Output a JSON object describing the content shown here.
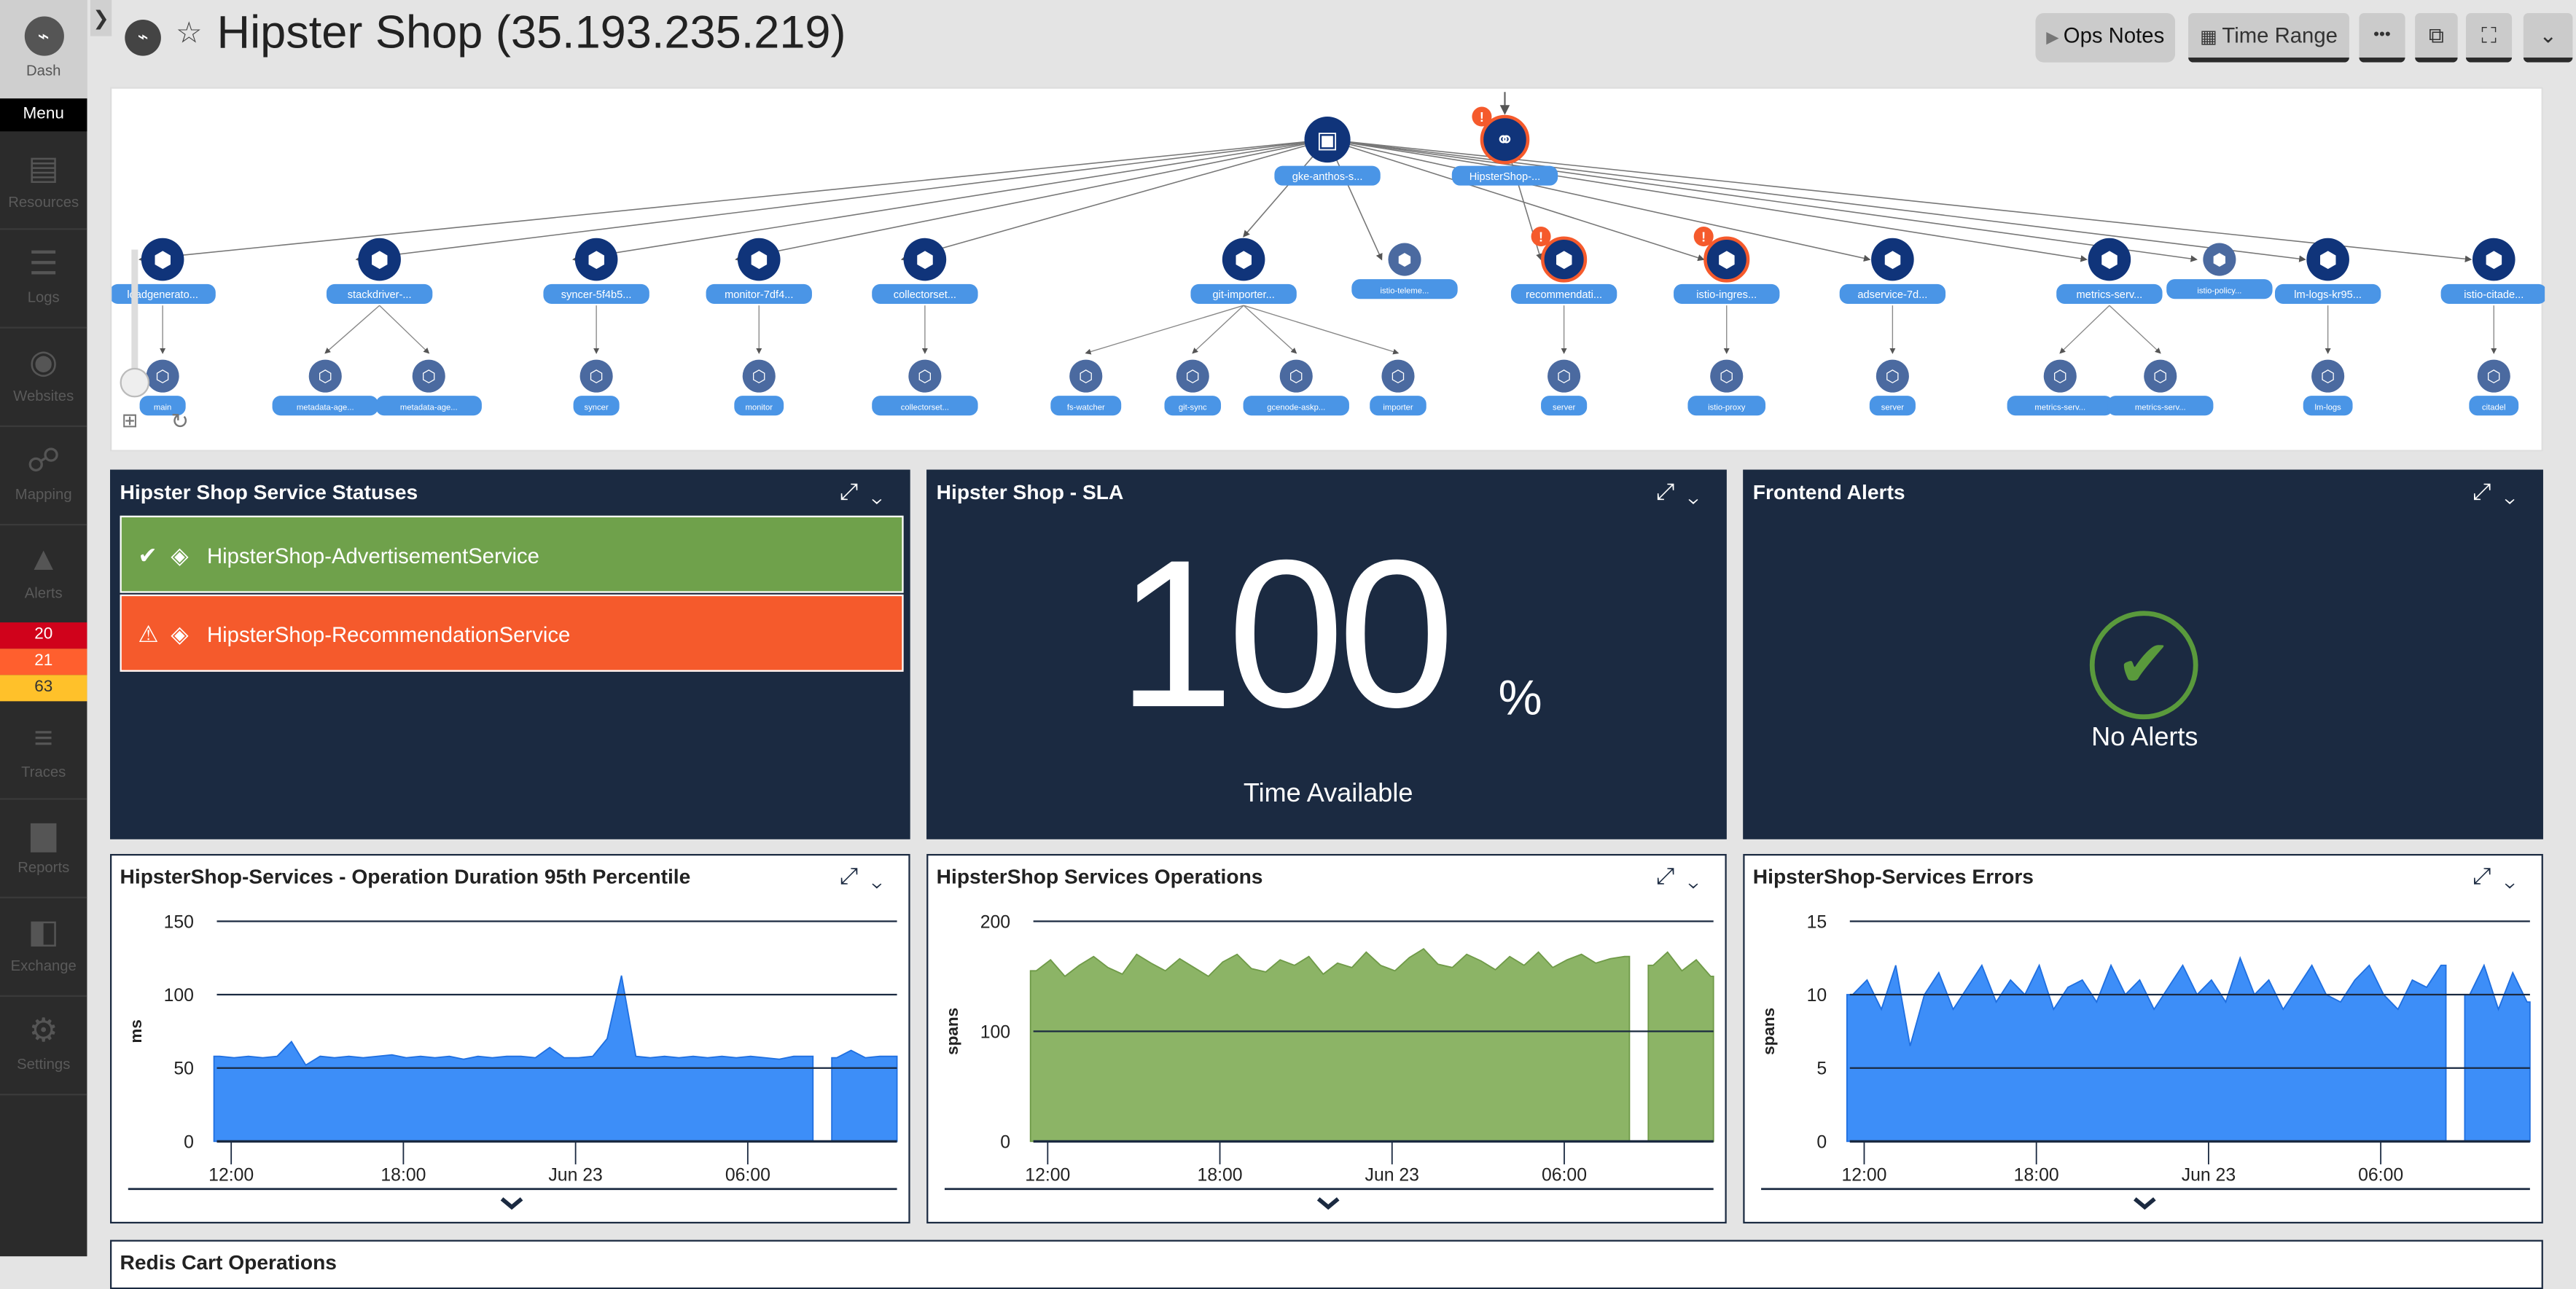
{
  "sidebar": {
    "dash_label": "Dash",
    "menu_label": "Menu",
    "items": [
      {
        "label": "Resources",
        "icon": "server-icon"
      },
      {
        "label": "Logs",
        "icon": "logs-icon"
      },
      {
        "label": "Websites",
        "icon": "globe-icon"
      },
      {
        "label": "Mapping",
        "icon": "mapping-icon"
      },
      {
        "label": "Alerts",
        "icon": "alert-icon"
      },
      {
        "label": "Traces",
        "icon": "traces-icon"
      },
      {
        "label": "Reports",
        "icon": "reports-icon"
      },
      {
        "label": "Exchange",
        "icon": "exchange-icon"
      },
      {
        "label": "Settings",
        "icon": "gear-icon"
      }
    ],
    "alert_counts": [
      {
        "value": "20",
        "color": "#d0021b"
      },
      {
        "value": "21",
        "color": "#ff5f2e"
      },
      {
        "value": "63",
        "color": "#ffc12a"
      }
    ]
  },
  "header": {
    "title": "Hipster Shop (35.193.235.219)",
    "ops_notes": "Ops Notes",
    "time_range": "Time Range"
  },
  "topology": {
    "top": [
      {
        "label": "gke-anthos-s...",
        "alert": false
      },
      {
        "label": "HipsterShop-...",
        "alert": true
      }
    ],
    "row1": [
      {
        "label": "loadgenerato..."
      },
      {
        "label": "stackdriver-..."
      },
      {
        "label": "syncer-5f4b5..."
      },
      {
        "label": "monitor-7df4..."
      },
      {
        "label": "collectorset..."
      },
      {
        "label": "git-importer..."
      },
      {
        "label": "istio-teleme..."
      },
      {
        "label": "recommendati...",
        "alert": true
      },
      {
        "label": "istio-ingres...",
        "alert": true
      },
      {
        "label": "adservice-7d..."
      },
      {
        "label": "metrics-serv..."
      },
      {
        "label": "istio-policy..."
      },
      {
        "label": "lm-logs-kr95..."
      },
      {
        "label": "istio-citade..."
      }
    ],
    "row2": [
      {
        "label": "main"
      },
      {
        "label": "metadata-age..."
      },
      {
        "label": "metadata-age..."
      },
      {
        "label": "syncer"
      },
      {
        "label": "monitor"
      },
      {
        "label": "collectorset..."
      },
      {
        "label": "fs-watcher"
      },
      {
        "label": "git-sync"
      },
      {
        "label": "gcenode-askp..."
      },
      {
        "label": "importer"
      },
      {
        "label": "server"
      },
      {
        "label": "istio-proxy"
      },
      {
        "label": "server"
      },
      {
        "label": "metrics-serv..."
      },
      {
        "label": "metrics-serv..."
      },
      {
        "label": "lm-logs"
      },
      {
        "label": "citadel"
      }
    ]
  },
  "statuses": {
    "title": "Hipster Shop Service Statuses",
    "items": [
      {
        "label": "HipsterShop-AdvertisementService",
        "state": "ok",
        "color": "#6fa14b"
      },
      {
        "label": "HipsterShop-RecommendationService",
        "state": "warning",
        "color": "#f55a2c"
      }
    ]
  },
  "sla": {
    "title": "Hipster Shop - SLA",
    "value": "100",
    "unit": "%",
    "caption": "Time Available"
  },
  "frontend": {
    "title": "Frontend Alerts",
    "message": "No Alerts",
    "color": "#5a9a3c"
  },
  "bottom_panel": {
    "title": "Redis Cart Operations"
  },
  "chart_data": [
    {
      "type": "area",
      "title": "HipsterShop-Services - Operation Duration 95th Percentile",
      "ylabel": "ms",
      "ylim": [
        0,
        150
      ],
      "yticks": [
        0,
        50,
        100,
        150
      ],
      "xticks": [
        "12:00",
        "18:00",
        "Jun 23",
        "06:00"
      ],
      "color": "#3d8ef8",
      "grid": true,
      "x": [
        "11:30",
        "12:00",
        "12:30",
        "13:00",
        "13:30",
        "14:00",
        "14:30",
        "15:00",
        "15:30",
        "16:00",
        "16:30",
        "17:00",
        "17:30",
        "18:00",
        "18:30",
        "19:00",
        "19:30",
        "20:00",
        "20:30",
        "21:00",
        "21:30",
        "22:00",
        "22:30",
        "23:00",
        "23:30",
        "00:00",
        "00:30",
        "01:00",
        "01:30",
        "02:00",
        "02:30",
        "03:00",
        "03:30",
        "04:00",
        "04:30",
        "05:00",
        "05:30",
        "06:00",
        "06:30",
        "07:00",
        "07:30",
        "08:00",
        "08:30",
        "09:00",
        "09:30",
        "10:00",
        "10:30",
        "11:00"
      ],
      "values": [
        58,
        57,
        58,
        57,
        58,
        68,
        52,
        58,
        57,
        58,
        57,
        58,
        59,
        57,
        58,
        57,
        58,
        56,
        58,
        57,
        58,
        58,
        57,
        64,
        57,
        57,
        58,
        70,
        113,
        58,
        57,
        58,
        57,
        58,
        57,
        58,
        57,
        58,
        57,
        56,
        58,
        58,
        null,
        57,
        62,
        57,
        58,
        58
      ]
    },
    {
      "type": "area",
      "title": "HipsterShop Services Operations",
      "ylabel": "spans",
      "ylim": [
        0,
        200
      ],
      "yticks": [
        0,
        100,
        200
      ],
      "xticks": [
        "12:00",
        "18:00",
        "Jun 23",
        "06:00"
      ],
      "color": "#8cb466",
      "grid": true,
      "x": [
        "11:30",
        "12:00",
        "12:30",
        "13:00",
        "13:30",
        "14:00",
        "14:30",
        "15:00",
        "15:30",
        "16:00",
        "16:30",
        "17:00",
        "17:30",
        "18:00",
        "18:30",
        "19:00",
        "19:30",
        "20:00",
        "20:30",
        "21:00",
        "21:30",
        "22:00",
        "22:30",
        "23:00",
        "23:30",
        "00:00",
        "00:30",
        "01:00",
        "01:30",
        "02:00",
        "02:30",
        "03:00",
        "03:30",
        "04:00",
        "04:30",
        "05:00",
        "05:30",
        "06:00",
        "06:30",
        "07:00",
        "07:30",
        "08:00",
        "08:30",
        "09:00",
        "09:30",
        "10:00",
        "10:30",
        "11:00"
      ],
      "values": [
        155,
        165,
        150,
        160,
        168,
        158,
        152,
        170,
        162,
        155,
        166,
        158,
        150,
        163,
        170,
        157,
        154,
        165,
        160,
        168,
        152,
        162,
        158,
        172,
        160,
        155,
        167,
        175,
        161,
        158,
        170,
        164,
        156,
        168,
        160,
        172,
        158,
        165,
        170,
        162,
        166,
        168,
        null,
        160,
        172,
        155,
        165,
        150
      ]
    },
    {
      "type": "area",
      "title": "HipsterShop-Services Errors",
      "ylabel": "spans",
      "ylim": [
        0,
        15
      ],
      "yticks": [
        0,
        5,
        10,
        15
      ],
      "xticks": [
        "12:00",
        "18:00",
        "Jun 23",
        "06:00"
      ],
      "color": "#3d8ef8",
      "grid": true,
      "x": [
        "11:30",
        "12:00",
        "12:30",
        "13:00",
        "13:30",
        "14:00",
        "14:30",
        "15:00",
        "15:30",
        "16:00",
        "16:30",
        "17:00",
        "17:30",
        "18:00",
        "18:30",
        "19:00",
        "19:30",
        "20:00",
        "20:30",
        "21:00",
        "21:30",
        "22:00",
        "22:30",
        "23:00",
        "23:30",
        "00:00",
        "00:30",
        "01:00",
        "01:30",
        "02:00",
        "02:30",
        "03:00",
        "03:30",
        "04:00",
        "04:30",
        "05:00",
        "05:30",
        "06:00",
        "06:30",
        "07:00",
        "07:30",
        "08:00",
        "08:30",
        "09:00",
        "09:30",
        "10:00",
        "10:30",
        "11:00"
      ],
      "values": [
        10,
        11,
        9,
        12,
        6.5,
        10,
        11.5,
        9,
        10.5,
        12,
        9.5,
        11,
        10,
        12,
        9,
        10.5,
        11,
        9.5,
        12,
        10,
        11,
        9,
        10.5,
        12,
        10,
        11,
        9.5,
        12.5,
        10,
        11,
        9,
        10.5,
        12,
        10,
        9.5,
        11,
        12,
        10,
        9,
        11,
        10.5,
        12,
        null,
        10,
        12,
        9,
        11.5,
        9.5
      ]
    }
  ]
}
